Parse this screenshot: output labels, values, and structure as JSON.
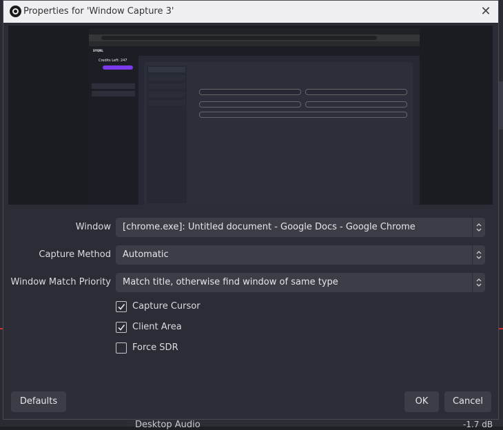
{
  "dialog": {
    "title": "Properties for 'Window Capture 3'",
    "close_glyph": "✕"
  },
  "preview": {
    "credits_text": "Credits Left: 247",
    "logo_text": "SYQRL"
  },
  "form": {
    "window": {
      "label": "Window",
      "value": "[chrome.exe]: Untitled document - Google Docs - Google Chrome"
    },
    "capture_method": {
      "label": "Capture Method",
      "value": "Automatic"
    },
    "match_priority": {
      "label": "Window Match Priority",
      "value": "Match title, otherwise find window of same type"
    }
  },
  "checks": [
    {
      "label": "Capture Cursor",
      "checked": true
    },
    {
      "label": "Client Area",
      "checked": true
    },
    {
      "label": "Force SDR",
      "checked": false
    }
  ],
  "buttons": {
    "defaults": "Defaults",
    "ok": "OK",
    "cancel": "Cancel"
  },
  "background": {
    "audio_label": "Desktop Audio",
    "audio_db": "-1.7 dB"
  },
  "icons": {
    "app": "obs-logo-icon",
    "close": "close-icon",
    "combo": "chevron-up-down-icon",
    "check": "checkmark-icon"
  }
}
